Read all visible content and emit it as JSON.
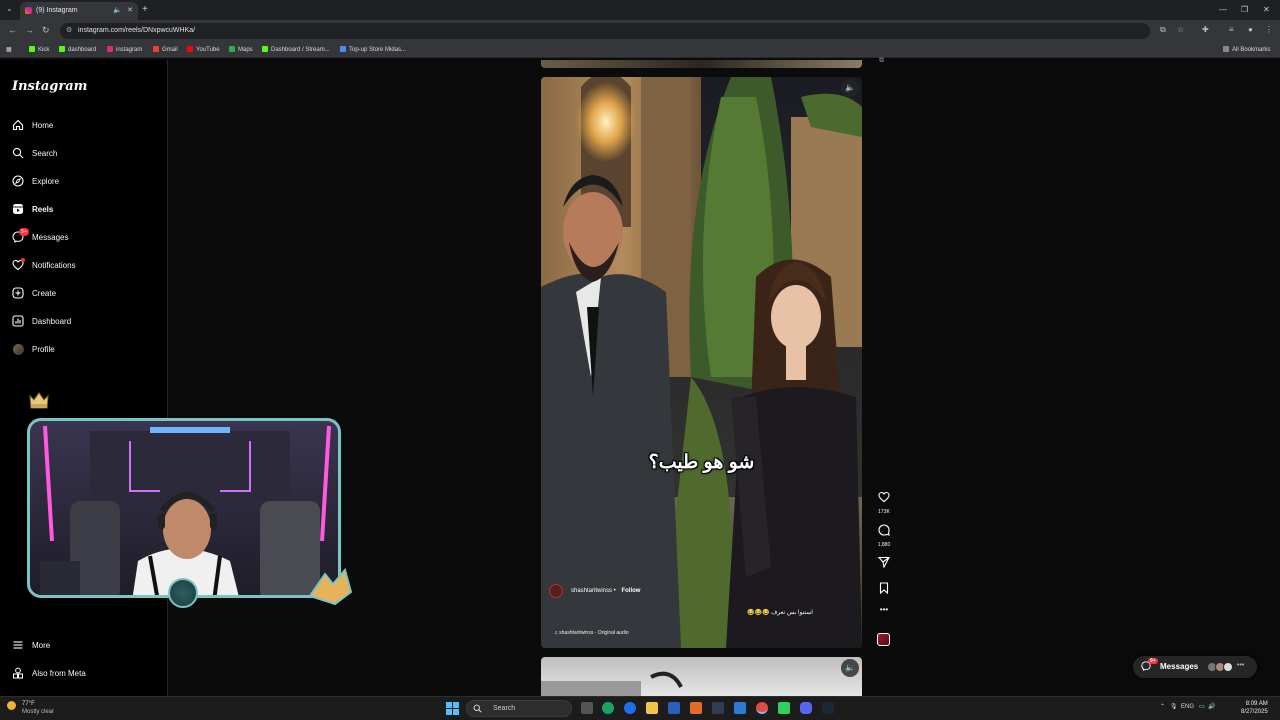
{
  "browser": {
    "tab_title": "(9) Instagram",
    "url": "instagram.com/reels/DNxpwcuWHKa/",
    "bookmarks": [
      "Kick",
      "dashboard",
      "instagram",
      "Gmail",
      "YouTube",
      "Maps",
      "Dashboard / Stream...",
      "Top-up Store Midas..."
    ],
    "all_bookmarks": "All Bookmarks"
  },
  "sidebar": {
    "logo": "Instagram",
    "items": [
      {
        "label": "Home",
        "icon": "home-icon"
      },
      {
        "label": "Search",
        "icon": "search-icon"
      },
      {
        "label": "Explore",
        "icon": "compass-icon"
      },
      {
        "label": "Reels",
        "icon": "reels-icon",
        "active": true
      },
      {
        "label": "Messages",
        "icon": "messenger-icon",
        "badge": "9+"
      },
      {
        "label": "Notifications",
        "icon": "heart-icon"
      },
      {
        "label": "Create",
        "icon": "plus-square-icon"
      },
      {
        "label": "Dashboard",
        "icon": "chart-icon"
      },
      {
        "label": "Profile",
        "icon": "avatar-icon"
      }
    ],
    "more": "More",
    "also_from_meta": "Also from Meta"
  },
  "reel": {
    "caption": "شو هو طيب؟",
    "username": "shashtaritwinss",
    "follow": "Follow",
    "description": "استنوا بس تعرف 😂😂😂",
    "audio": "shashtaritwinss · Original audio",
    "likes": "173K",
    "comments": "1,880"
  },
  "messages_pill": {
    "label": "Messages",
    "badge": "9+"
  },
  "taskbar": {
    "temperature": "77°F",
    "weather": "Mostly clear",
    "search": "Search",
    "lang": "ENG",
    "time": "8:09 AM",
    "date": "8/27/2025"
  }
}
